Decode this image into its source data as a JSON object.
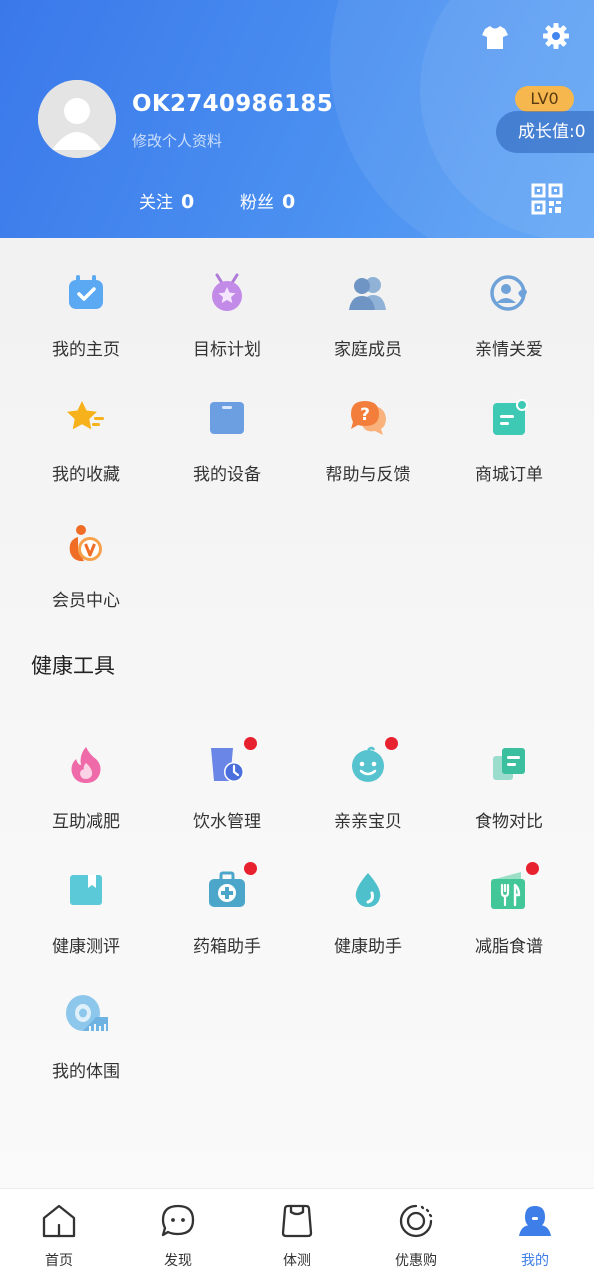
{
  "header": {
    "username": "OK2740986185",
    "edit_profile": "修改个人资料",
    "level": "LV0",
    "growth": "成长值:0",
    "follow_label": "关注",
    "follow_count": "0",
    "fans_label": "粉丝",
    "fans_count": "0",
    "icons": [
      "tshirt-icon",
      "gear-icon",
      "qr-code-icon"
    ],
    "gradient": [
      "#3a78ea",
      "#5aa2f6"
    ]
  },
  "menu": [
    {
      "label": "我的主页",
      "icon": "calendar-check-icon"
    },
    {
      "label": "目标计划",
      "icon": "medal-icon"
    },
    {
      "label": "家庭成员",
      "icon": "family-icon"
    },
    {
      "label": "亲情关爱",
      "icon": "care-icon"
    },
    {
      "label": "我的收藏",
      "icon": "star-icon"
    },
    {
      "label": "我的设备",
      "icon": "device-icon"
    },
    {
      "label": "帮助与反馈",
      "icon": "help-icon"
    },
    {
      "label": "商城订单",
      "icon": "order-icon"
    },
    {
      "label": "会员中心",
      "icon": "vip-icon"
    }
  ],
  "tools": {
    "title": "健康工具",
    "items": [
      {
        "label": "互助减肥",
        "icon": "flame-icon",
        "dot": false
      },
      {
        "label": "饮水管理",
        "icon": "water-cup-icon",
        "dot": true
      },
      {
        "label": "亲亲宝贝",
        "icon": "baby-icon",
        "dot": true
      },
      {
        "label": "食物对比",
        "icon": "compare-icon",
        "dot": false
      },
      {
        "label": "健康测评",
        "icon": "bookmark-icon",
        "dot": false
      },
      {
        "label": "药箱助手",
        "icon": "medicine-box-icon",
        "dot": true
      },
      {
        "label": "健康助手",
        "icon": "drop-icon",
        "dot": false
      },
      {
        "label": "减脂食谱",
        "icon": "recipe-icon",
        "dot": true
      },
      {
        "label": "我的体围",
        "icon": "tape-measure-icon",
        "dot": false
      }
    ]
  },
  "nav": [
    {
      "label": "首页",
      "icon": "home-icon"
    },
    {
      "label": "发现",
      "icon": "chat-bubble-icon"
    },
    {
      "label": "体测",
      "icon": "scale-bag-icon"
    },
    {
      "label": "优惠购",
      "icon": "coupon-icon"
    },
    {
      "label": "我的",
      "icon": "profile-icon",
      "active": true
    }
  ],
  "colors": {
    "accent": "#3d7ee8",
    "badge": "#f6b74e",
    "dot": "#e8212f"
  }
}
